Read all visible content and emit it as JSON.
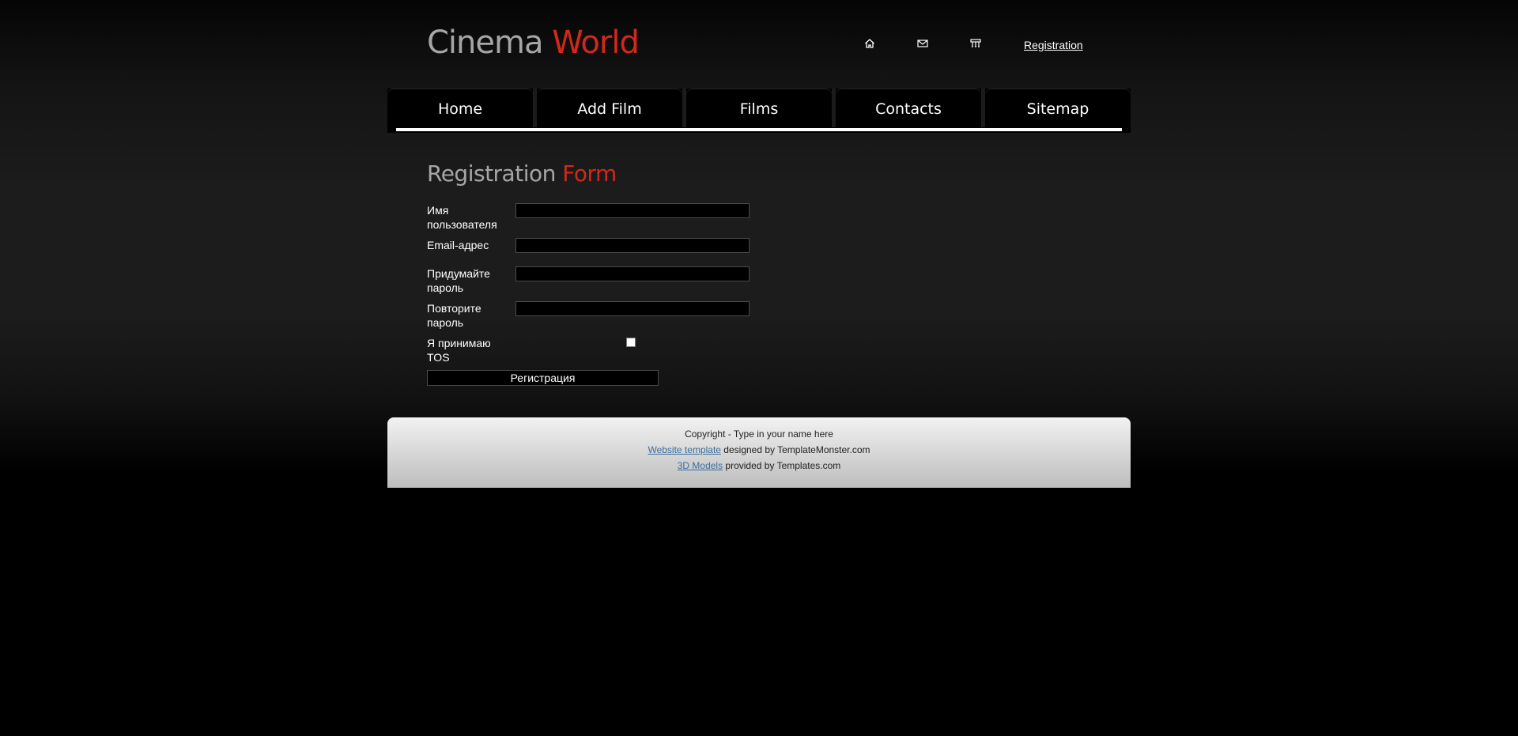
{
  "header": {
    "logo_part1": "Cinema",
    "logo_part2": "World",
    "icons": [
      "home-icon",
      "mail-icon",
      "sitemap-icon"
    ],
    "registration_link": "Registration"
  },
  "nav": {
    "tabs": [
      {
        "label": "Home"
      },
      {
        "label": "Add Film"
      },
      {
        "label": "Films"
      },
      {
        "label": "Contacts"
      },
      {
        "label": "Sitemap"
      }
    ]
  },
  "content": {
    "title_part1": "Registration",
    "title_part2": "Form",
    "form": {
      "fields": [
        {
          "label": "Имя пользователя",
          "value": ""
        },
        {
          "label": "Email-адрес",
          "value": ""
        },
        {
          "label": "Придумайте пароль",
          "value": ""
        },
        {
          "label": "Повторите пароль",
          "value": ""
        }
      ],
      "tos_label": "Я принимаю TOS",
      "tos_checked": false,
      "submit_label": "Регистрация"
    }
  },
  "footer": {
    "copyright": "Copyright - Type in your name here",
    "template_link": "Website template",
    "template_text": " designed by TemplateMonster.com",
    "models_link": "3D Models",
    "models_text": " provided by Templates.com"
  },
  "colors": {
    "accent": "#d2281c",
    "logo_grey": "#a6a6a6",
    "link_blue": "#3a6e9e"
  }
}
